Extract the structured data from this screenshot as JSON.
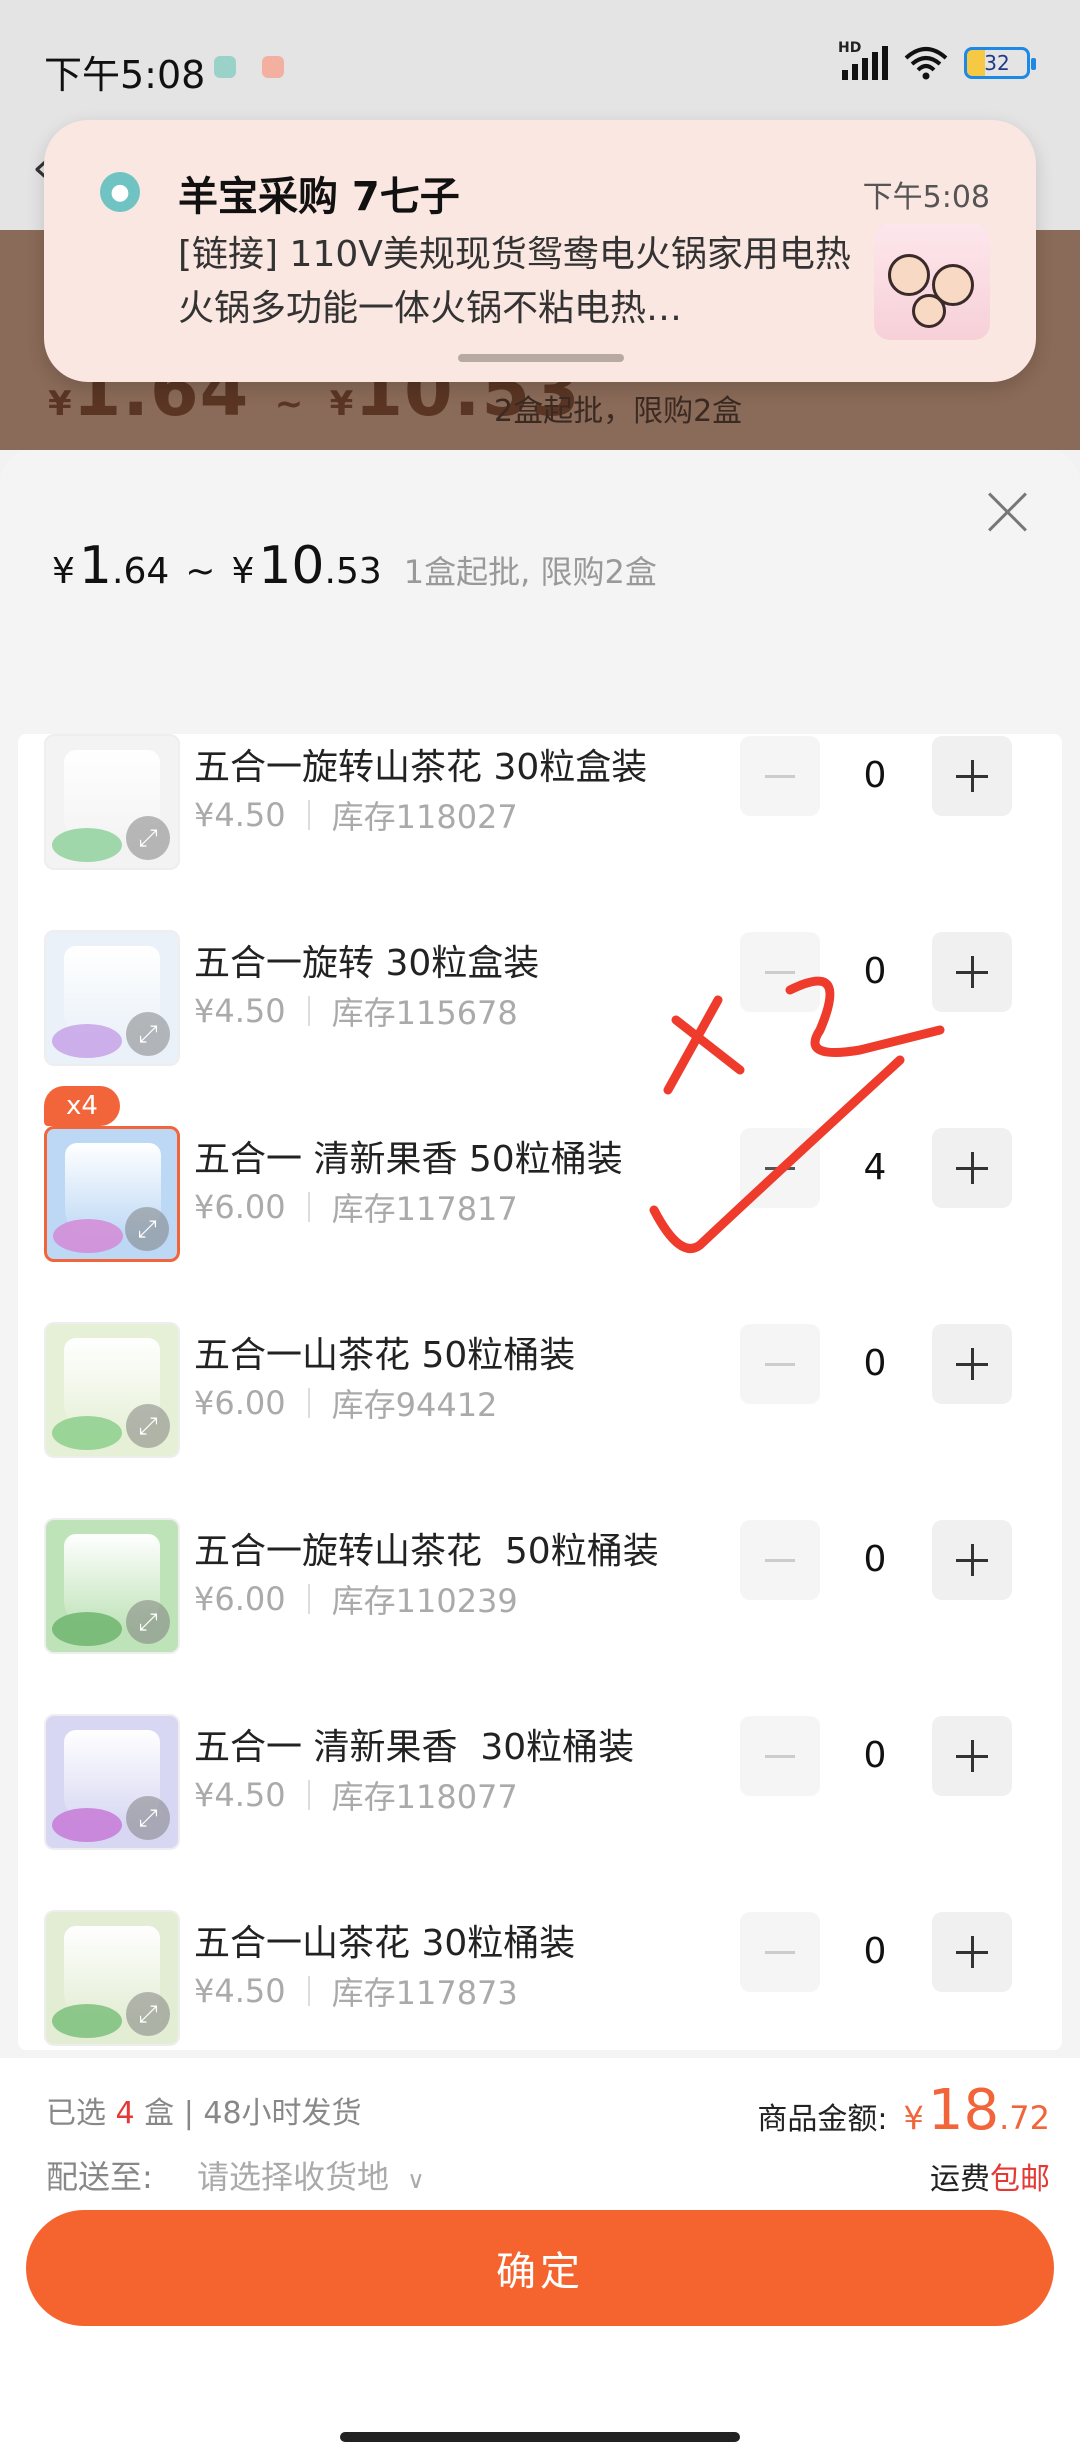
{
  "status_bar": {
    "time": "下午5:08",
    "battery": "32",
    "hd": "HD"
  },
  "background": {
    "price_cur1": "¥",
    "price_low": "1.64",
    "range_sep": "~",
    "price_cur2": "¥",
    "price_high": "10.53",
    "moq": "2盒起批，限购2盒"
  },
  "notification": {
    "title": "羊宝采购 7七子",
    "time": "下午5:08",
    "body": "[链接] 110V美规现货鸳鸯电火锅家用电热火锅多功能一体火锅不粘电热…"
  },
  "sheet": {
    "price_cur": "¥",
    "price_low_int": "1",
    "price_low_dec": ".64",
    "sep": "~",
    "price_high_int": "10",
    "price_high_dec": ".53",
    "note": "1盒起批, 限购2盒"
  },
  "products": [
    {
      "name": "五合一旋转山茶花 30粒盒装",
      "price": "¥4.50",
      "stock": "库存118027",
      "qty": "0",
      "colors": [
        "#f3f3f3",
        "#8fd19e"
      ]
    },
    {
      "name": "五合一旋转 30粒盒装",
      "price": "¥4.50",
      "stock": "库存115678",
      "qty": "0",
      "colors": [
        "#eaf1f8",
        "#c7a3e8"
      ]
    },
    {
      "name": "五合一 清新果香 50粒桶装",
      "price": "¥6.00",
      "stock": "库存117817",
      "qty": "4",
      "badge": "x4",
      "colors": [
        "#bcd8f5",
        "#d58ad6"
      ]
    },
    {
      "name": "五合一山茶花 50粒桶装",
      "price": "¥6.00",
      "stock": "库存94412",
      "qty": "0",
      "colors": [
        "#e6f0d7",
        "#8ccf8c"
      ]
    },
    {
      "name": "五合一旋转山茶花  50粒桶装",
      "price": "¥6.00",
      "stock": "库存110239",
      "qty": "0",
      "colors": [
        "#bfe3b8",
        "#6fb56f"
      ]
    },
    {
      "name": "五合一 清新果香  30粒桶装",
      "price": "¥4.50",
      "stock": "库存118077",
      "qty": "0",
      "colors": [
        "#d7d7f3",
        "#c77ad6"
      ]
    },
    {
      "name": "五合一山茶花 30粒桶装",
      "price": "¥4.50",
      "stock": "库存117873",
      "qty": "0",
      "colors": [
        "#e3edd4",
        "#7cbf7c"
      ]
    }
  ],
  "footer": {
    "selected_prefix": "已选 ",
    "selected_count": "4",
    "selected_suffix": " 盒 | 48小时发货",
    "amount_label": "商品金额:",
    "amount_cur": "¥",
    "amount_int": "18",
    "amount_dec": ".72",
    "ship_label": "配送至:",
    "ship_hint": "请选择收货地",
    "freight_label": "运费",
    "freight_value": "包邮",
    "confirm": "确定"
  },
  "handwriting": "x2"
}
